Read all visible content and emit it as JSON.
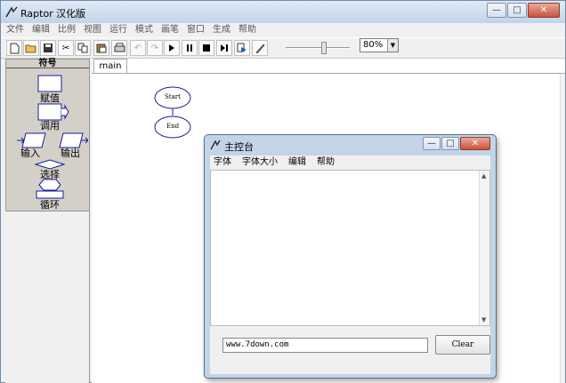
{
  "app": {
    "title": "Raptor 汉化版"
  },
  "menu": [
    "文件",
    "编辑",
    "比例",
    "视图",
    "运行",
    "模式",
    "画笔",
    "窗口",
    "生成",
    "帮助"
  ],
  "toolbar": {
    "icons": [
      "new-file-icon",
      "open-folder-icon",
      "save-icon",
      "cut-icon",
      "copy-icon",
      "paste-icon",
      "print-icon",
      "undo-icon",
      "redo-icon",
      "play-icon",
      "pause-icon",
      "stop-icon",
      "step-icon",
      "test-icon",
      "pen-icon"
    ],
    "zoom_value": "80%"
  },
  "symbols": {
    "header": "符号",
    "assign": "赋值",
    "call": "调用",
    "input": "输入",
    "output": "输出",
    "selection": "选择",
    "loop": "循环"
  },
  "canvas": {
    "tab": "main",
    "start": "Start",
    "end": "End"
  },
  "console": {
    "title": "主控台",
    "menu": [
      "字体",
      "字体大小",
      "编辑",
      "帮助"
    ],
    "input_value": "www.7down.com",
    "clear_label": "Clear"
  }
}
